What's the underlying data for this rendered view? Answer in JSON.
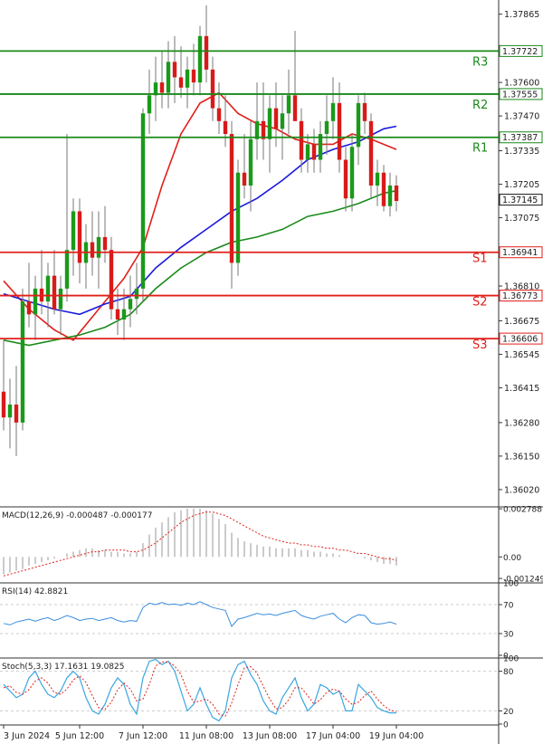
{
  "chart_data": {
    "type": "candlestick",
    "price_axis": {
      "min": 1.3596,
      "max": 1.3792,
      "ticks": [
        "1.37865",
        "1.37600",
        "1.37470",
        "1.37335",
        "1.37205",
        "1.37075",
        "1.36810",
        "1.36675",
        "1.36545",
        "1.36415",
        "1.36280",
        "1.36150",
        "1.36020"
      ],
      "current_price": "1.37145"
    },
    "levels": [
      {
        "label": "R3",
        "value": 1.37722,
        "text": "1.37722",
        "color": "#1a8a1a"
      },
      {
        "label": "R2",
        "value": 1.37555,
        "text": "1.37555",
        "color": "#1a8a1a"
      },
      {
        "label": "R1",
        "value": 1.37387,
        "text": "1.37387",
        "color": "#1a8a1a"
      },
      {
        "label": "S1",
        "value": 1.36941,
        "text": "1.36941",
        "color": "#e0201a"
      },
      {
        "label": "S2",
        "value": 1.36773,
        "text": "1.36773",
        "color": "#e0201a"
      },
      {
        "label": "S3",
        "value": 1.36606,
        "text": "1.36606",
        "color": "#e0201a"
      }
    ],
    "time_labels": [
      {
        "index": 0,
        "text": "3 Jun 2024"
      },
      {
        "index": 12,
        "text": "5 Jun 12:00"
      },
      {
        "index": 22,
        "text": "7 Jun 12:00"
      },
      {
        "index": 32,
        "text": "11 Jun 08:00"
      },
      {
        "index": 42,
        "text": "13 Jun 08:00"
      },
      {
        "index": 52,
        "text": "17 Jun 04:00"
      },
      {
        "index": 62,
        "text": "19 Jun 04:00"
      }
    ],
    "candles": [
      [
        1.364,
        1.366,
        1.3625,
        1.363
      ],
      [
        1.363,
        1.3645,
        1.3618,
        1.3635
      ],
      [
        1.3635,
        1.365,
        1.3615,
        1.3628
      ],
      [
        1.3628,
        1.368,
        1.3625,
        1.3675
      ],
      [
        1.3675,
        1.369,
        1.3665,
        1.367
      ],
      [
        1.367,
        1.3685,
        1.366,
        1.368
      ],
      [
        1.368,
        1.3695,
        1.367,
        1.3675
      ],
      [
        1.3675,
        1.369,
        1.3665,
        1.3685
      ],
      [
        1.3685,
        1.3695,
        1.367,
        1.3672
      ],
      [
        1.3672,
        1.3685,
        1.3662,
        1.368
      ],
      [
        1.368,
        1.374,
        1.3675,
        1.3695
      ],
      [
        1.3695,
        1.3715,
        1.3685,
        1.371
      ],
      [
        1.371,
        1.3715,
        1.3682,
        1.369
      ],
      [
        1.369,
        1.3705,
        1.368,
        1.3698
      ],
      [
        1.3698,
        1.371,
        1.3685,
        1.3692
      ],
      [
        1.3692,
        1.371,
        1.368,
        1.37
      ],
      [
        1.37,
        1.3712,
        1.369,
        1.3695
      ],
      [
        1.3695,
        1.37,
        1.3668,
        1.3672
      ],
      [
        1.3672,
        1.368,
        1.3662,
        1.3668
      ],
      [
        1.3668,
        1.368,
        1.366,
        1.3672
      ],
      [
        1.3672,
        1.3685,
        1.3665,
        1.3676
      ],
      [
        1.3676,
        1.369,
        1.367,
        1.368
      ],
      [
        1.368,
        1.375,
        1.3675,
        1.3748
      ],
      [
        1.3748,
        1.3765,
        1.374,
        1.3755
      ],
      [
        1.3755,
        1.377,
        1.3745,
        1.376
      ],
      [
        1.376,
        1.3772,
        1.375,
        1.3756
      ],
      [
        1.3756,
        1.3776,
        1.375,
        1.3768
      ],
      [
        1.3768,
        1.3778,
        1.3752,
        1.3762
      ],
      [
        1.3762,
        1.3774,
        1.3754,
        1.3758
      ],
      [
        1.3758,
        1.377,
        1.375,
        1.3765
      ],
      [
        1.3765,
        1.3775,
        1.3755,
        1.376
      ],
      [
        1.376,
        1.3782,
        1.3755,
        1.3778
      ],
      [
        1.3778,
        1.379,
        1.376,
        1.3765
      ],
      [
        1.3765,
        1.377,
        1.3745,
        1.375
      ],
      [
        1.375,
        1.376,
        1.374,
        1.3745
      ],
      [
        1.3745,
        1.3755,
        1.3735,
        1.374
      ],
      [
        1.374,
        1.3745,
        1.368,
        1.369
      ],
      [
        1.369,
        1.373,
        1.3685,
        1.3725
      ],
      [
        1.3725,
        1.374,
        1.3715,
        1.372
      ],
      [
        1.372,
        1.3745,
        1.371,
        1.3738
      ],
      [
        1.3738,
        1.376,
        1.373,
        1.3745
      ],
      [
        1.3745,
        1.376,
        1.373,
        1.3738
      ],
      [
        1.3738,
        1.3755,
        1.3725,
        1.375
      ],
      [
        1.375,
        1.376,
        1.3735,
        1.3742
      ],
      [
        1.3742,
        1.3755,
        1.373,
        1.3748
      ],
      [
        1.3748,
        1.3765,
        1.374,
        1.3755
      ],
      [
        1.3755,
        1.378,
        1.3745,
        1.3745
      ],
      [
        1.3745,
        1.375,
        1.3725,
        1.373
      ],
      [
        1.373,
        1.374,
        1.3725,
        1.3736
      ],
      [
        1.3736,
        1.3742,
        1.3725,
        1.373
      ],
      [
        1.373,
        1.3745,
        1.3725,
        1.374
      ],
      [
        1.374,
        1.3755,
        1.3732,
        1.3745
      ],
      [
        1.3745,
        1.3762,
        1.3738,
        1.3752
      ],
      [
        1.3752,
        1.376,
        1.3725,
        1.373
      ],
      [
        1.373,
        1.3735,
        1.371,
        1.3715
      ],
      [
        1.3715,
        1.374,
        1.371,
        1.3735
      ],
      [
        1.3735,
        1.3755,
        1.3728,
        1.3752
      ],
      [
        1.3752,
        1.3756,
        1.374,
        1.3745
      ],
      [
        1.3745,
        1.3748,
        1.3715,
        1.372
      ],
      [
        1.372,
        1.373,
        1.3712,
        1.3725
      ],
      [
        1.3725,
        1.3728,
        1.371,
        1.3712
      ],
      [
        1.3712,
        1.3725,
        1.3708,
        1.372
      ],
      [
        1.372,
        1.3724,
        1.371,
        1.3714
      ]
    ],
    "moving_averages": [
      {
        "color": "#e0201a",
        "points": [
          [
            0,
            1.3683
          ],
          [
            4,
            1.3672
          ],
          [
            8,
            1.3664
          ],
          [
            11,
            1.366
          ],
          [
            15,
            1.3672
          ],
          [
            19,
            1.3684
          ],
          [
            22,
            1.3696
          ],
          [
            25,
            1.372
          ],
          [
            28,
            1.374
          ],
          [
            31,
            1.3752
          ],
          [
            34,
            1.3756
          ],
          [
            37,
            1.3748
          ],
          [
            40,
            1.3744
          ],
          [
            43,
            1.3742
          ],
          [
            46,
            1.3738
          ],
          [
            49,
            1.3736
          ],
          [
            52,
            1.3736
          ],
          [
            55,
            1.374
          ],
          [
            58,
            1.3738
          ],
          [
            62,
            1.3734
          ]
        ]
      },
      {
        "color": "#1a1adc",
        "points": [
          [
            0,
            1.3678
          ],
          [
            4,
            1.3675
          ],
          [
            8,
            1.3672
          ],
          [
            12,
            1.367
          ],
          [
            16,
            1.3674
          ],
          [
            20,
            1.3677
          ],
          [
            24,
            1.3688
          ],
          [
            28,
            1.3696
          ],
          [
            32,
            1.3703
          ],
          [
            36,
            1.371
          ],
          [
            40,
            1.3715
          ],
          [
            44,
            1.3722
          ],
          [
            48,
            1.373
          ],
          [
            52,
            1.3734
          ],
          [
            56,
            1.3737
          ],
          [
            60,
            1.3742
          ],
          [
            62,
            1.3743
          ]
        ]
      },
      {
        "color": "#1a8a1a",
        "points": [
          [
            0,
            1.366
          ],
          [
            4,
            1.3658
          ],
          [
            8,
            1.366
          ],
          [
            12,
            1.3662
          ],
          [
            16,
            1.3665
          ],
          [
            20,
            1.367
          ],
          [
            24,
            1.368
          ],
          [
            28,
            1.3688
          ],
          [
            32,
            1.3694
          ],
          [
            36,
            1.3698
          ],
          [
            40,
            1.37
          ],
          [
            44,
            1.3703
          ],
          [
            48,
            1.3708
          ],
          [
            52,
            1.371
          ],
          [
            56,
            1.3713
          ],
          [
            60,
            1.3717
          ],
          [
            62,
            1.3718
          ]
        ]
      }
    ],
    "macd": {
      "label": "MACD(12,26,9) -0.000487 -0.000177",
      "min": -0.0014,
      "max": 0.0029,
      "ticks": [
        "0.002788",
        "0.00",
        "-0.001249"
      ],
      "hist": [
        -0.001,
        -0.0009,
        -0.0008,
        -0.0007,
        -0.0005,
        -0.0004,
        -0.0003,
        -0.0002,
        -0.0001,
        0.0,
        0.0002,
        0.0003,
        0.0004,
        0.0005,
        0.0005,
        0.0004,
        0.0004,
        0.0003,
        0.0003,
        0.0002,
        0.0002,
        0.0003,
        0.0008,
        0.0013,
        0.0017,
        0.002,
        0.0023,
        0.0026,
        0.0027,
        0.0028,
        0.0028,
        0.0028,
        0.0027,
        0.0025,
        0.0022,
        0.0019,
        0.0014,
        0.0011,
        0.0009,
        0.0008,
        0.0007,
        0.0006,
        0.0006,
        0.0005,
        0.0005,
        0.0005,
        0.0005,
        0.0004,
        0.0004,
        0.0003,
        0.0003,
        0.0002,
        0.0002,
        0.0001,
        0.0,
        0.0,
        0.0,
        -0.0001,
        -0.0002,
        -0.0003,
        -0.0004,
        -0.0004,
        -0.0005
      ],
      "signal": [
        -0.0011,
        -0.001,
        -0.0009,
        -0.0008,
        -0.0007,
        -0.0006,
        -0.0005,
        -0.0004,
        -0.0003,
        -0.0002,
        -0.0001,
        0.0,
        0.0001,
        0.0002,
        0.0003,
        0.0003,
        0.0004,
        0.0004,
        0.0004,
        0.0004,
        0.0003,
        0.0003,
        0.0004,
        0.0006,
        0.0008,
        0.0011,
        0.0014,
        0.0017,
        0.002,
        0.0022,
        0.0024,
        0.0025,
        0.0026,
        0.0026,
        0.0025,
        0.0024,
        0.0022,
        0.002,
        0.0018,
        0.0016,
        0.0014,
        0.0012,
        0.0011,
        0.001,
        0.0009,
        0.0008,
        0.0008,
        0.0007,
        0.0007,
        0.0006,
        0.0006,
        0.0005,
        0.0005,
        0.0004,
        0.0004,
        0.0003,
        0.0002,
        0.0002,
        0.0001,
        0.0,
        -0.0001,
        -0.0001,
        -0.0002
      ]
    },
    "rsi": {
      "label": "RSI(14) 42.8821",
      "min": 0,
      "max": 100,
      "ticks": [
        100,
        70,
        30,
        0
      ],
      "values": [
        44,
        42,
        46,
        48,
        50,
        47,
        50,
        52,
        48,
        51,
        55,
        52,
        48,
        50,
        51,
        48,
        50,
        52,
        48,
        46,
        48,
        47,
        66,
        72,
        70,
        73,
        70,
        71,
        69,
        72,
        70,
        74,
        70,
        66,
        64,
        62,
        40,
        50,
        52,
        55,
        58,
        56,
        57,
        55,
        58,
        60,
        62,
        55,
        52,
        50,
        54,
        56,
        58,
        50,
        45,
        52,
        56,
        55,
        45,
        43,
        44,
        46,
        43
      ]
    },
    "stoch": {
      "label": "Stoch(5,3,3) 17.1631 19.0825",
      "min": 0,
      "max": 100,
      "ticks": [
        100,
        80,
        20,
        0
      ],
      "k": [
        60,
        50,
        40,
        45,
        70,
        80,
        60,
        45,
        40,
        50,
        70,
        80,
        70,
        40,
        20,
        15,
        30,
        55,
        70,
        60,
        30,
        15,
        70,
        95,
        98,
        90,
        95,
        80,
        50,
        20,
        30,
        55,
        30,
        10,
        5,
        20,
        70,
        90,
        95,
        75,
        60,
        35,
        20,
        15,
        40,
        55,
        70,
        40,
        20,
        30,
        60,
        55,
        45,
        50,
        20,
        20,
        60,
        50,
        40,
        25,
        20,
        17,
        17
      ],
      "d": [
        55,
        58,
        48,
        45,
        52,
        65,
        70,
        62,
        48,
        45,
        53,
        67,
        73,
        63,
        43,
        25,
        22,
        33,
        52,
        62,
        53,
        35,
        38,
        60,
        88,
        94,
        94,
        88,
        75,
        50,
        33,
        35,
        38,
        30,
        15,
        12,
        32,
        60,
        85,
        87,
        77,
        57,
        38,
        23,
        25,
        37,
        55,
        55,
        43,
        30,
        37,
        48,
        53,
        50,
        38,
        30,
        33,
        43,
        50,
        38,
        28,
        21,
        19
      ]
    }
  }
}
